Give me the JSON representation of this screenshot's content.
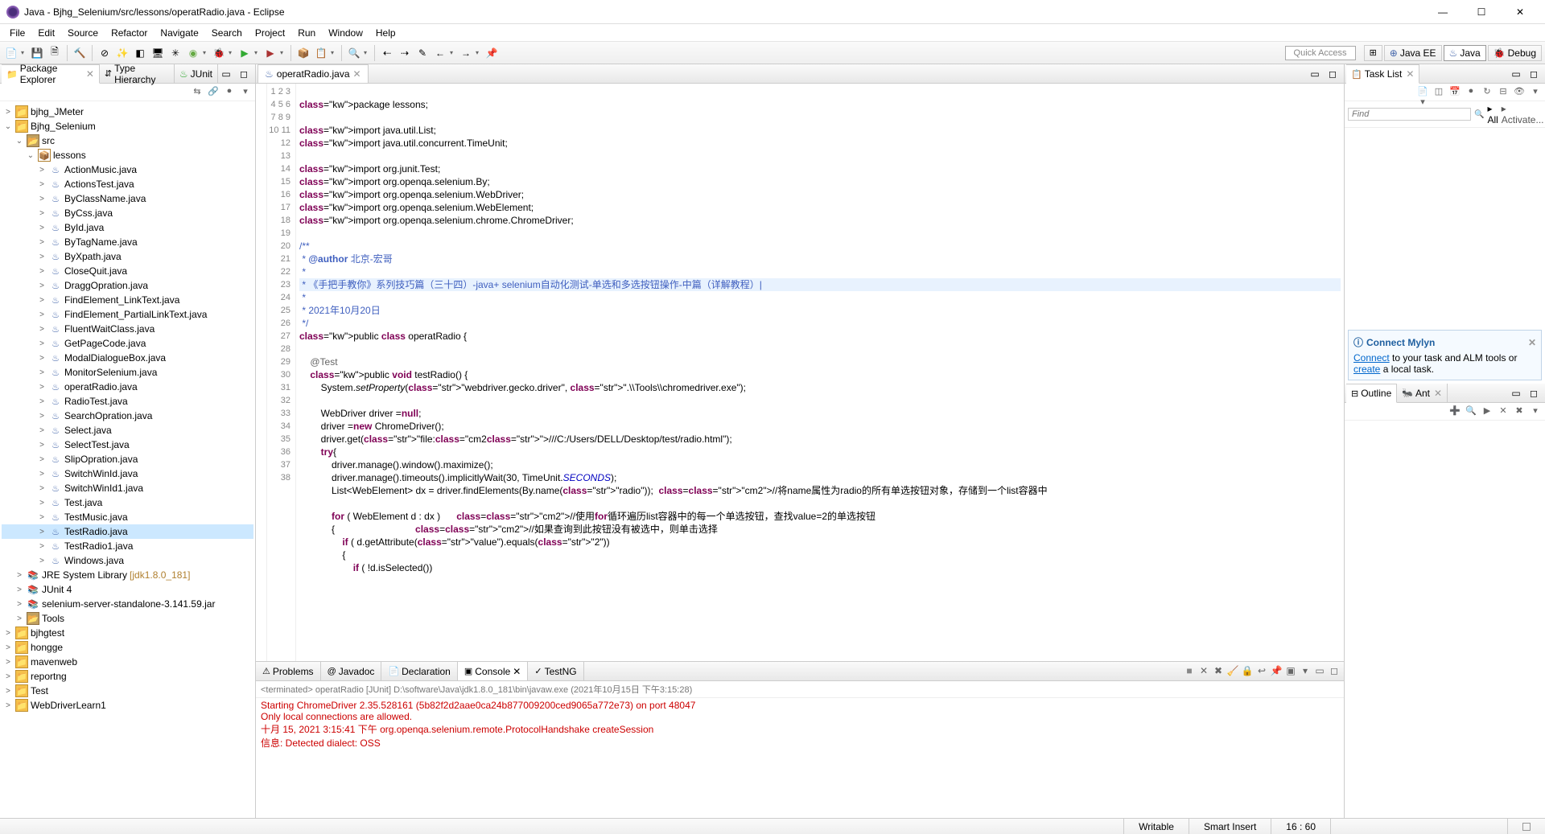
{
  "title": "Java - Bjhg_Selenium/src/lessons/operatRadio.java - Eclipse",
  "menu": [
    "File",
    "Edit",
    "Source",
    "Refactor",
    "Navigate",
    "Search",
    "Project",
    "Run",
    "Window",
    "Help"
  ],
  "quick_access": "Quick Access",
  "perspectives": [
    {
      "label": "Java EE",
      "active": false
    },
    {
      "label": "Java",
      "active": true
    },
    {
      "label": "Debug",
      "active": false
    }
  ],
  "left": {
    "tabs": [
      {
        "label": "Package Explorer",
        "active": true
      },
      {
        "label": "Type Hierarchy",
        "active": false
      },
      {
        "label": "JUnit",
        "active": false
      }
    ],
    "projects": [
      "bjhg_JMeter"
    ],
    "active_project": "Bjhg_Selenium",
    "src_folder": "src",
    "package": "lessons",
    "files": [
      "ActionMusic.java",
      "ActionsTest.java",
      "ByClassName.java",
      "ByCss.java",
      "ById.java",
      "ByTagName.java",
      "ByXpath.java",
      "CloseQuit.java",
      "DraggOpration.java",
      "FindElement_LinkText.java",
      "FindElement_PartialLinkText.java",
      "FluentWaitClass.java",
      "GetPageCode.java",
      "ModalDialogueBox.java",
      "MonitorSelenium.java",
      "operatRadio.java",
      "RadioTest.java",
      "SearchOpration.java",
      "Select.java",
      "SelectTest.java",
      "SlipOpration.java",
      "SwitchWinId.java",
      "SwitchWinId1.java",
      "Test.java",
      "TestMusic.java",
      "TestRadio.java",
      "TestRadio1.java",
      "Windows.java"
    ],
    "selected_file": "TestRadio.java",
    "libs": [
      {
        "label": "JRE System Library",
        "suffix": "[jdk1.8.0_181]"
      },
      {
        "label": "JUnit 4",
        "suffix": ""
      },
      {
        "label": "selenium-server-standalone-3.141.59.jar",
        "suffix": ""
      }
    ],
    "tools_folder": "Tools",
    "other_projects": [
      "bjhgtest",
      "hongge",
      "mavenweb",
      "reportng",
      "Test",
      "WebDriverLearn1"
    ]
  },
  "editor": {
    "tab": "operatRadio.java",
    "lines": [
      "",
      "package lessons;",
      "",
      "import java.util.List;",
      "import java.util.concurrent.TimeUnit;",
      "",
      "import org.junit.Test;",
      "import org.openqa.selenium.By;",
      "import org.openqa.selenium.WebDriver;",
      "import org.openqa.selenium.WebElement;",
      "import org.openqa.selenium.chrome.ChromeDriver;",
      "",
      "/**",
      " * @author 北京-宏哥",
      " *",
      " * 《手把手教你》系列技巧篇（三十四）-java+ selenium自动化测试-单选和多选按钮操作-中篇（详解教程）|",
      " *",
      " * 2021年10月20日",
      " */",
      "public class operatRadio {",
      "",
      "    @Test",
      "    public void testRadio() {",
      "        System.setProperty(\"webdriver.gecko.driver\", \".\\\\Tools\\\\chromedriver.exe\");",
      "",
      "        WebDriver driver =null;",
      "        driver =new ChromeDriver();",
      "        driver.get(\"file:///C:/Users/DELL/Desktop/test/radio.html\");",
      "        try{",
      "            driver.manage().window().maximize();",
      "            driver.manage().timeouts().implicitlyWait(30, TimeUnit.SECONDS);",
      "            List<WebElement> dx = driver.findElements(By.name(\"radio\"));  //将name属性为radio的所有单选按钮对象，存储到一个list容器中",
      "",
      "            for ( WebElement d : dx )      //使用for循环遍历list容器中的每一个单选按钮，查找value=2的单选按钮",
      "            {                              //如果查询到此按钮没有被选中，则单击选择",
      "                if ( d.getAttribute(\"value\").equals(\"2\"))",
      "                {",
      "                    if ( !d.isSelected())"
    ]
  },
  "console": {
    "tabs": [
      "Problems",
      "Javadoc",
      "Declaration",
      "Console",
      "TestNG"
    ],
    "active_tab": "Console",
    "header": "<terminated> operatRadio [JUnit] D:\\software\\Java\\jdk1.8.0_181\\bin\\javaw.exe (2021年10月15日 下午3:15:28)",
    "lines": [
      "Starting ChromeDriver 2.35.528161 (5b82f2d2aae0ca24b877009200ced9065a772e73) on port 48047",
      "Only local connections are allowed.",
      "十月 15, 2021 3:15:41 下午 org.openqa.selenium.remote.ProtocolHandshake createSession",
      "信息: Detected dialect: OSS"
    ]
  },
  "right": {
    "tasklist_tab": "Task List",
    "find_placeholder": "Find",
    "all_label": "All",
    "activate_label": "Activate...",
    "mylyn_title": "Connect Mylyn",
    "mylyn_text1": "Connect",
    "mylyn_text2": " to your task and ALM tools or ",
    "mylyn_text3": "create",
    "mylyn_text4": " a local task.",
    "outline_tab": "Outline",
    "ant_tab": "Ant"
  },
  "status": {
    "writable": "Writable",
    "insert": "Smart Insert",
    "pos": "16 : 60"
  },
  "chart_data": null
}
